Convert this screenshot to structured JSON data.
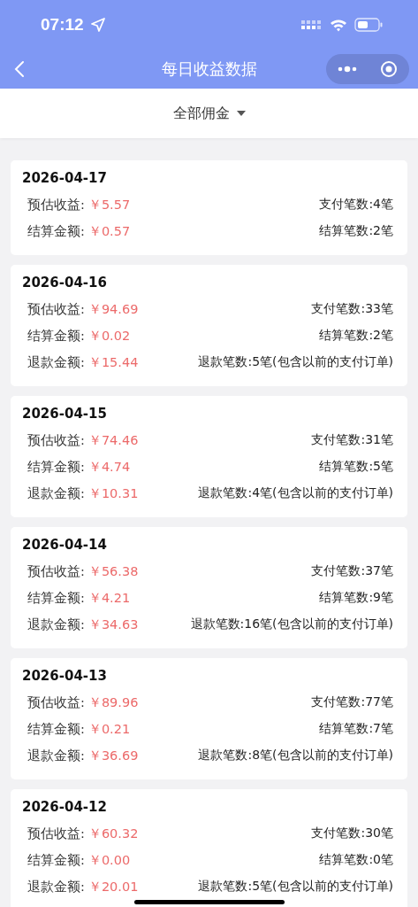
{
  "status_bar": {
    "time": "07:12"
  },
  "nav": {
    "title": "每日收益数据"
  },
  "filter": {
    "label": "全部佣金"
  },
  "days": [
    {
      "date": "2026-04-17",
      "rows": [
        {
          "label": "预估收益:",
          "amount": "￥5.57",
          "count": "支付笔数:4笔"
        },
        {
          "label": "结算金额:",
          "amount": "￥0.57",
          "count": "结算笔数:2笔"
        }
      ]
    },
    {
      "date": "2026-04-16",
      "rows": [
        {
          "label": "预估收益:",
          "amount": "￥94.69",
          "count": "支付笔数:33笔"
        },
        {
          "label": "结算金额:",
          "amount": "￥0.02",
          "count": "结算笔数:2笔"
        },
        {
          "label": "退款金额:",
          "amount": "￥15.44",
          "count": "退款笔数:5笔(包含以前的支付订单)"
        }
      ]
    },
    {
      "date": "2026-04-15",
      "rows": [
        {
          "label": "预估收益:",
          "amount": "￥74.46",
          "count": "支付笔数:31笔"
        },
        {
          "label": "结算金额:",
          "amount": "￥4.74",
          "count": "结算笔数:5笔"
        },
        {
          "label": "退款金额:",
          "amount": "￥10.31",
          "count": "退款笔数:4笔(包含以前的支付订单)"
        }
      ]
    },
    {
      "date": "2026-04-14",
      "rows": [
        {
          "label": "预估收益:",
          "amount": "￥56.38",
          "count": "支付笔数:37笔"
        },
        {
          "label": "结算金额:",
          "amount": "￥4.21",
          "count": "结算笔数:9笔"
        },
        {
          "label": "退款金额:",
          "amount": "￥34.63",
          "count": "退款笔数:16笔(包含以前的支付订单)"
        }
      ]
    },
    {
      "date": "2026-04-13",
      "rows": [
        {
          "label": "预估收益:",
          "amount": "￥89.96",
          "count": "支付笔数:77笔"
        },
        {
          "label": "结算金额:",
          "amount": "￥0.21",
          "count": "结算笔数:7笔"
        },
        {
          "label": "退款金额:",
          "amount": "￥36.69",
          "count": "退款笔数:8笔(包含以前的支付订单)"
        }
      ]
    },
    {
      "date": "2026-04-12",
      "rows": [
        {
          "label": "预估收益:",
          "amount": "￥60.32",
          "count": "支付笔数:30笔"
        },
        {
          "label": "结算金额:",
          "amount": "￥0.00",
          "count": "结算笔数:0笔"
        },
        {
          "label": "退款金额:",
          "amount": "￥20.01",
          "count": "退款笔数:5笔(包含以前的支付订单)"
        }
      ]
    }
  ]
}
